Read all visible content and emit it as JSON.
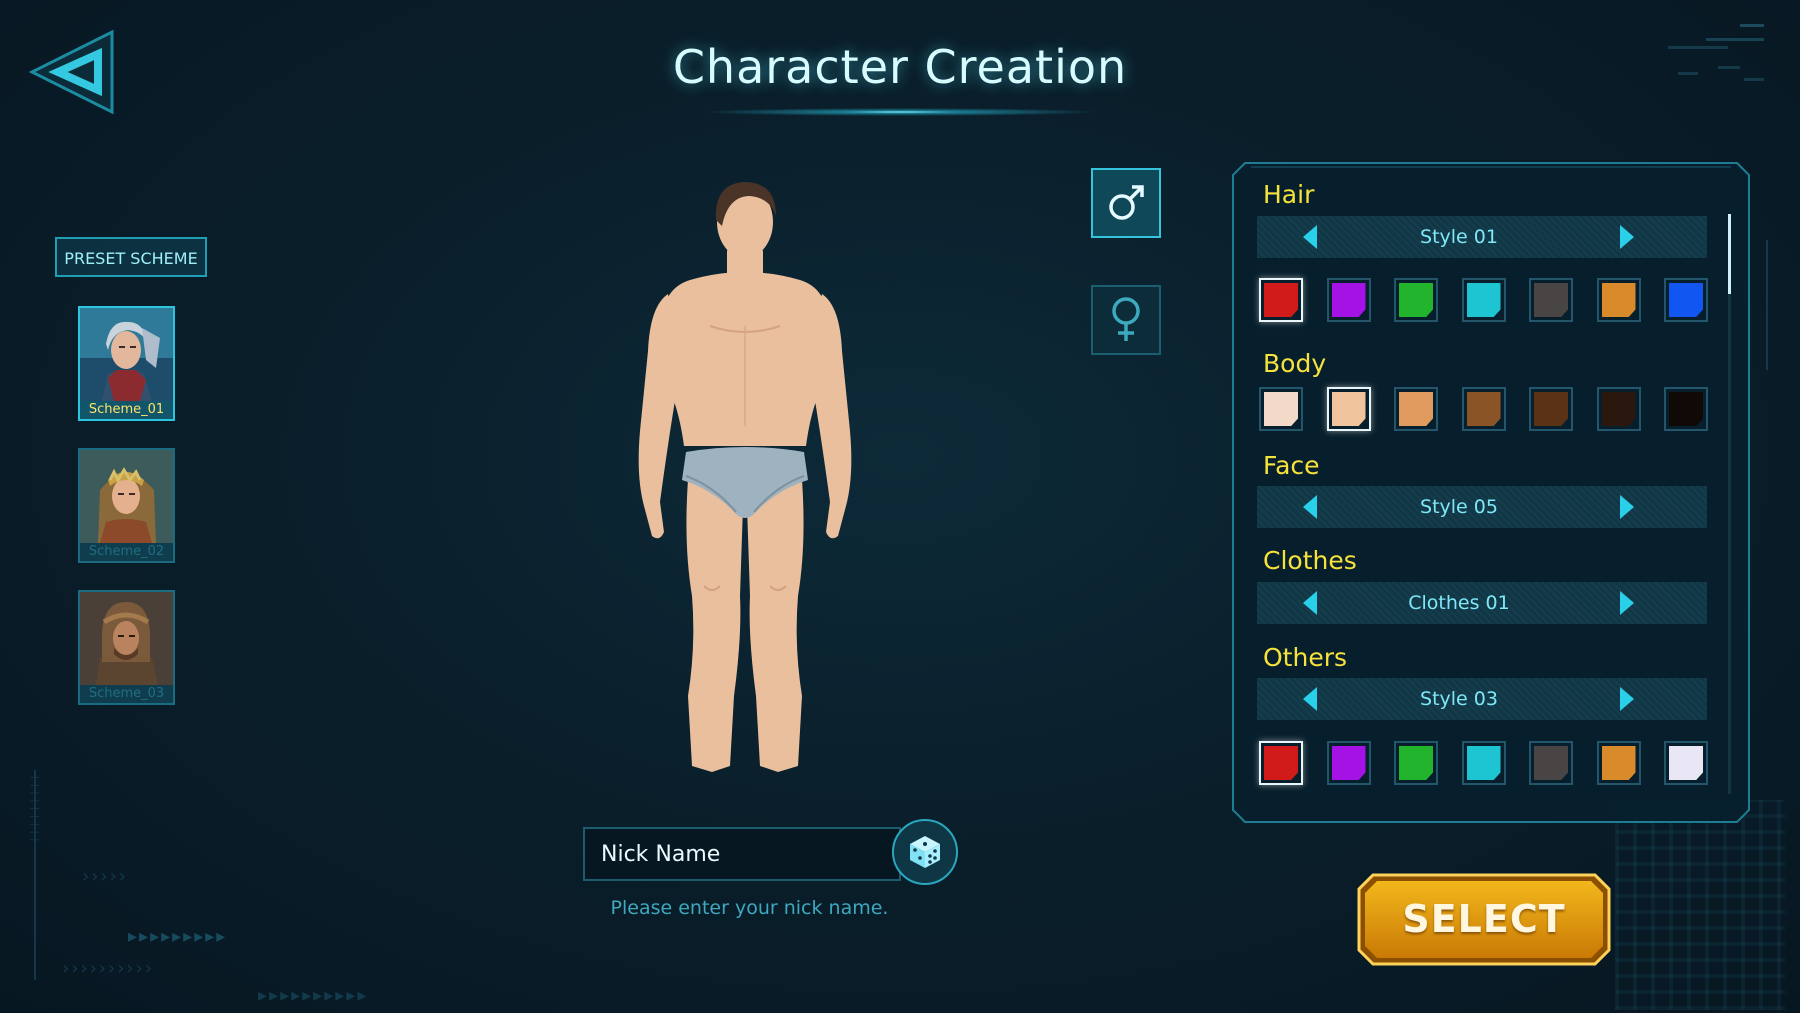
{
  "header": {
    "title": "Character Creation",
    "back_icon": "back-triangle-icon"
  },
  "preset": {
    "label": "PRESET SCHEME",
    "schemes": [
      {
        "label": "Scheme_01",
        "selected": true
      },
      {
        "label": "Scheme_02",
        "selected": false
      },
      {
        "label": "Scheme_03",
        "selected": false
      }
    ]
  },
  "gender": {
    "male_icon": "male-symbol-icon",
    "female_icon": "female-symbol-icon",
    "selected": "male"
  },
  "nickname": {
    "placeholder": "Nick Name",
    "hint": "Please enter your nick name.",
    "dice_icon": "dice-icon"
  },
  "customize": {
    "hair": {
      "label": "Hair",
      "style": "Style 01",
      "colors": [
        "#d11a1a",
        "#a412e6",
        "#22b42c",
        "#1cc5d1",
        "#4a4545",
        "#d98a2a",
        "#1156f0"
      ],
      "selected_color": 0
    },
    "body": {
      "label": "Body",
      "colors": [
        "#f3dac8",
        "#efc39c",
        "#e09a5e",
        "#8b5427",
        "#5a3317",
        "#2a170d",
        "#100906"
      ],
      "selected_color": 1
    },
    "face": {
      "label": "Face",
      "style": "Style 05"
    },
    "clothes": {
      "label": "Clothes",
      "style": "Clothes 01"
    },
    "others": {
      "label": "Others",
      "style": "Style 03",
      "colors": [
        "#d11a1a",
        "#a412e6",
        "#22b42c",
        "#1cc5d1",
        "#4a4545",
        "#d98a2a",
        "#e9e6f6"
      ],
      "selected_color": 0
    }
  },
  "select_button": {
    "label": "SELECT"
  },
  "colors": {
    "accent": "#2ad0ea",
    "section_title": "#f6e23c",
    "select_gold": "#e8a312"
  }
}
